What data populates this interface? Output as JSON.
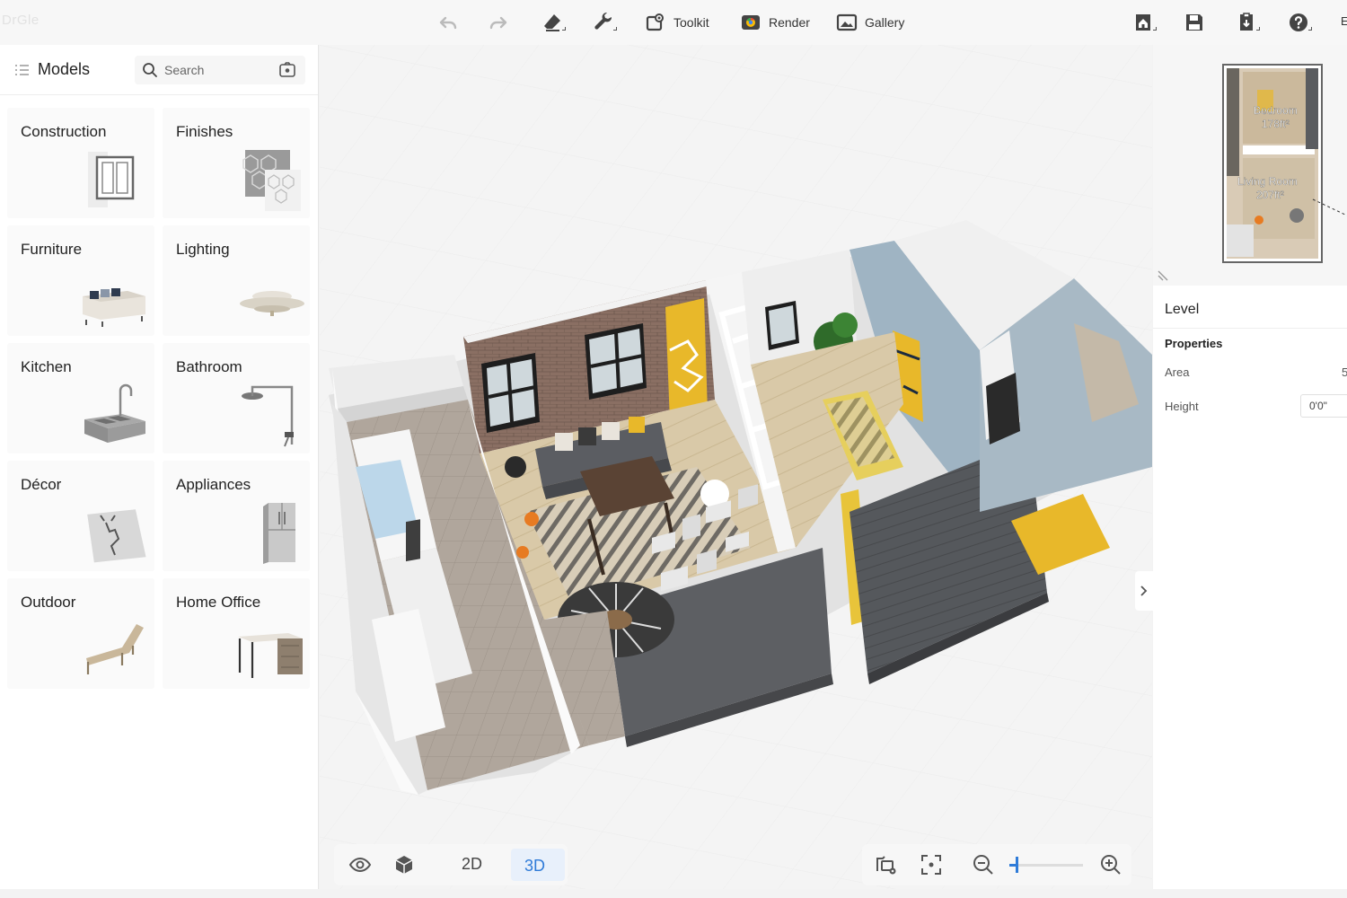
{
  "app": {
    "logo_text": "DrGle"
  },
  "toolbar": {
    "toolkit_label": "Toolkit",
    "render_label": "Render",
    "gallery_label": "Gallery",
    "edge_label": "E"
  },
  "sidebar": {
    "title": "Models",
    "search_placeholder": "Search",
    "categories": [
      {
        "label": "Construction"
      },
      {
        "label": "Finishes"
      },
      {
        "label": "Furniture"
      },
      {
        "label": "Lighting"
      },
      {
        "label": "Kitchen"
      },
      {
        "label": "Bathroom"
      },
      {
        "label": "Décor"
      },
      {
        "label": "Appliances"
      },
      {
        "label": "Outdoor"
      },
      {
        "label": "Home Office"
      }
    ]
  },
  "viewport": {
    "mode_2d": "2D",
    "mode_3d": "3D",
    "active_mode": "3D",
    "zoom_level": 0.1
  },
  "minimap": {
    "rooms": [
      {
        "name": "Bedroom",
        "area": "178ft²"
      },
      {
        "name": "Living Room",
        "area": "207ft²"
      }
    ]
  },
  "properties": {
    "section_title": "Level",
    "group_title": "Properties",
    "area_label": "Area",
    "area_value": "5",
    "height_label": "Height",
    "height_value": "0'0\""
  },
  "colors": {
    "accent": "#2f7bd8",
    "wall_blue": "#9fb4c3",
    "partition_dark": "#5a5c60",
    "accent_yellow": "#e8b82a"
  }
}
